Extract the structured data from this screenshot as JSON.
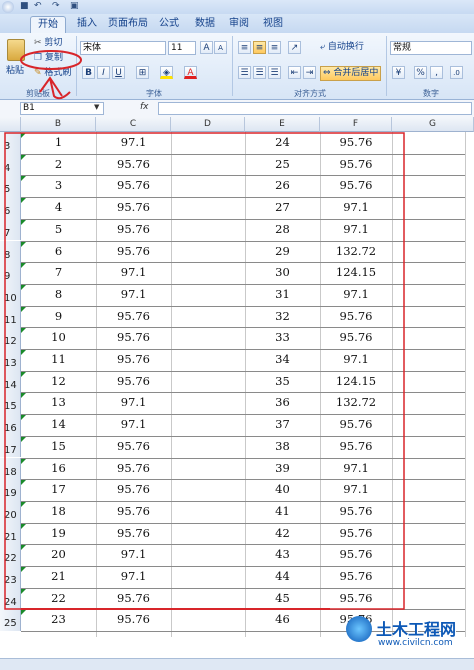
{
  "title_bar": {
    "quick_access": [
      "save-icon",
      "undo-icon",
      "redo-icon",
      "print-icon"
    ]
  },
  "tabs": [
    {
      "label": "开始",
      "active": true
    },
    {
      "label": "插入",
      "active": false
    },
    {
      "label": "页面布局",
      "active": false
    },
    {
      "label": "公式",
      "active": false
    },
    {
      "label": "数据",
      "active": false
    },
    {
      "label": "审阅",
      "active": false
    },
    {
      "label": "视图",
      "active": false
    }
  ],
  "ribbon": {
    "clipboard": {
      "paste": "粘贴",
      "cut": "剪切",
      "copy": "复制",
      "format_painter": "格式刷",
      "group": "剪贴板"
    },
    "font": {
      "name": "宋体",
      "size": "11",
      "grow": "A",
      "shrink": "A",
      "bold": "B",
      "italic": "I",
      "underline": "U",
      "font_color": "A",
      "group": "字体"
    },
    "alignment": {
      "wrap_text": "自动换行",
      "merge_center": "合并后居中",
      "group": "对齐方式"
    },
    "number": {
      "format": "常规",
      "percent": "%",
      "comma": ",",
      "group": "数字"
    }
  },
  "formula_bar": {
    "name_box": "B1",
    "fx": "fx",
    "value": ""
  },
  "columns": [
    "B",
    "C",
    "D",
    "E",
    "F",
    "G"
  ],
  "rows": [
    {
      "r": "3",
      "b": "1",
      "c": "97.1",
      "e": "24",
      "f": "95.76"
    },
    {
      "r": "4",
      "b": "2",
      "c": "95.76",
      "e": "25",
      "f": "95.76"
    },
    {
      "r": "5",
      "b": "3",
      "c": "95.76",
      "e": "26",
      "f": "95.76"
    },
    {
      "r": "6",
      "b": "4",
      "c": "95.76",
      "e": "27",
      "f": "97.1"
    },
    {
      "r": "7",
      "b": "5",
      "c": "95.76",
      "e": "28",
      "f": "97.1"
    },
    {
      "r": "8",
      "b": "6",
      "c": "95.76",
      "e": "29",
      "f": "132.72"
    },
    {
      "r": "9",
      "b": "7",
      "c": "97.1",
      "e": "30",
      "f": "124.15"
    },
    {
      "r": "10",
      "b": "8",
      "c": "97.1",
      "e": "31",
      "f": "97.1"
    },
    {
      "r": "11",
      "b": "9",
      "c": "95.76",
      "e": "32",
      "f": "95.76"
    },
    {
      "r": "12",
      "b": "10",
      "c": "95.76",
      "e": "33",
      "f": "95.76"
    },
    {
      "r": "13",
      "b": "11",
      "c": "95.76",
      "e": "34",
      "f": "97.1"
    },
    {
      "r": "14",
      "b": "12",
      "c": "95.76",
      "e": "35",
      "f": "124.15"
    },
    {
      "r": "15",
      "b": "13",
      "c": "97.1",
      "e": "36",
      "f": "132.72"
    },
    {
      "r": "16",
      "b": "14",
      "c": "97.1",
      "e": "37",
      "f": "95.76"
    },
    {
      "r": "17",
      "b": "15",
      "c": "95.76",
      "e": "38",
      "f": "95.76"
    },
    {
      "r": "18",
      "b": "16",
      "c": "95.76",
      "e": "39",
      "f": "97.1"
    },
    {
      "r": "19",
      "b": "17",
      "c": "95.76",
      "e": "40",
      "f": "97.1"
    },
    {
      "r": "20",
      "b": "18",
      "c": "95.76",
      "e": "41",
      "f": "95.76"
    },
    {
      "r": "21",
      "b": "19",
      "c": "95.76",
      "e": "42",
      "f": "95.76"
    },
    {
      "r": "22",
      "b": "20",
      "c": "97.1",
      "e": "43",
      "f": "95.76"
    },
    {
      "r": "23",
      "b": "21",
      "c": "97.1",
      "e": "44",
      "f": "95.76"
    },
    {
      "r": "24",
      "b": "22",
      "c": "95.76",
      "e": "45",
      "f": "95.76"
    },
    {
      "r": "25",
      "b": "23",
      "c": "95.76",
      "e": "46",
      "f": "95.76"
    }
  ],
  "watermark": {
    "text": "土木工程网",
    "url": "www.civilcn.com"
  },
  "colors": {
    "ribbon": "#d7e5f6",
    "annotation_red": "#d8252a",
    "accent": "#15428b"
  }
}
